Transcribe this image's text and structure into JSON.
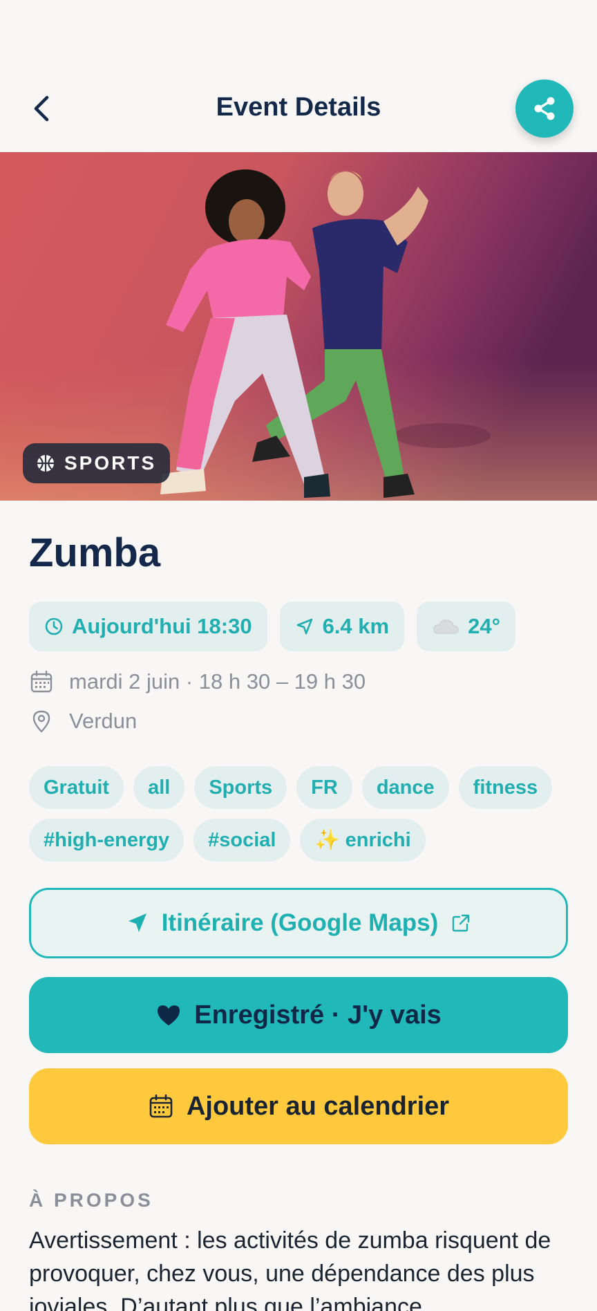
{
  "header": {
    "title": "Event Details"
  },
  "hero": {
    "category_label": "SPORTS",
    "category_icon": "basketball-icon"
  },
  "event": {
    "title": "Zumba",
    "stats": [
      {
        "icon": "clock-icon",
        "label": "Aujourd'hui 18:30"
      },
      {
        "icon": "navigation-arrow-icon",
        "label": "6.4 km"
      },
      {
        "icon": "cloud-icon",
        "label": "24°"
      }
    ],
    "date_line": "mardi 2 juin · 18 h 30 – 19 h 30",
    "location": "Verdun",
    "tags": [
      "Gratuit",
      "all",
      "Sports",
      "FR",
      "dance",
      "fitness",
      "#high-energy",
      "#social",
      "✨ enrichi"
    ]
  },
  "actions": {
    "maps_label": "Itinéraire (Google Maps)",
    "saved_label": "Enregistré · J'y vais",
    "calendar_label": "Ajouter au calendrier"
  },
  "about": {
    "heading": "À PROPOS",
    "text": "Avertissement : les activités de zumba risquent de provoquer, chez vous, une dépendance des plus joviales. D’autant plus que l’ambiance"
  },
  "colors": {
    "accent": "#20b8b8",
    "chip_bg": "#e3efee",
    "calendar_button": "#ffc93d",
    "title_text": "#14294a",
    "muted_text": "#8a8f9a"
  }
}
